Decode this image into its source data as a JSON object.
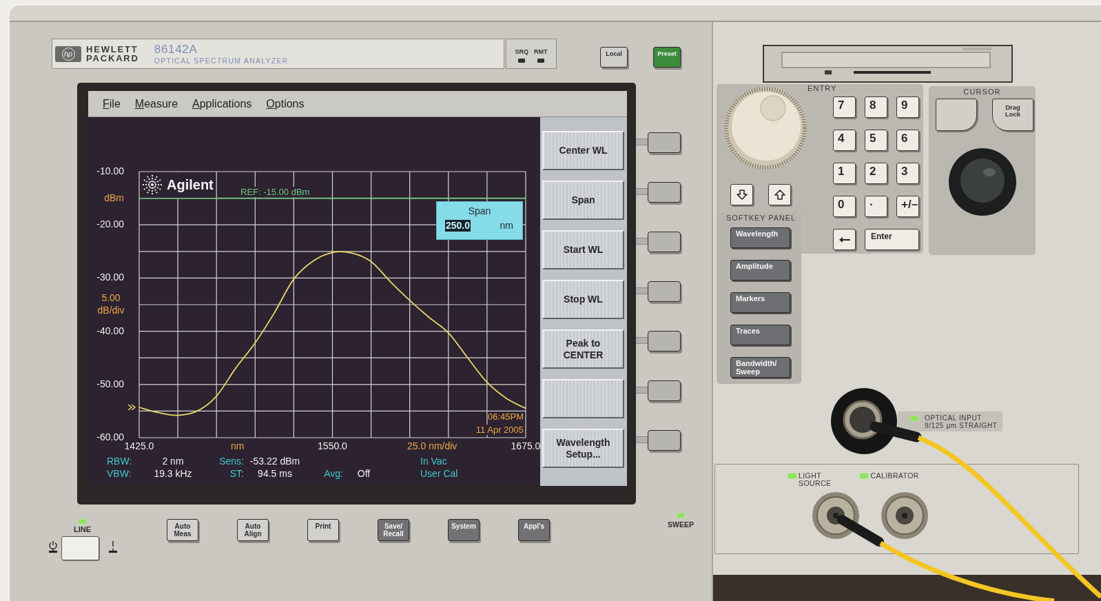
{
  "header": {
    "logo_text": "hp",
    "brand": [
      "HEWLETT",
      "PACKARD"
    ],
    "model": "86142A",
    "product": "OPTICAL SPECTRUM ANALYZER",
    "indicators": [
      {
        "label": "SRQ",
        "on": false
      },
      {
        "label": "RMT",
        "on": false
      }
    ]
  },
  "top_buttons": [
    {
      "label": "Local",
      "kind": "plain"
    },
    {
      "label": "Preset",
      "kind": "green"
    }
  ],
  "screen": {
    "menu": [
      "File",
      "Measure",
      "Applications",
      "Options"
    ],
    "logo_text": "Agilent",
    "y_scale": {
      "value": "5.00",
      "unit": "dB/div"
    },
    "x_scale": "25.0 nm/div",
    "time": "06:45PM",
    "date": "11 Apr 2005",
    "span_dialog": {
      "title": "Span",
      "value": "250.0",
      "unit": "nm"
    },
    "chart_data": {
      "type": "line",
      "xlabel": "nm",
      "ylabel": "dBm",
      "x": [
        1425,
        1437.5,
        1450,
        1462.5,
        1475,
        1487.5,
        1500,
        1512.5,
        1525,
        1537.5,
        1550,
        1562.5,
        1575,
        1587.5,
        1600,
        1612.5,
        1625,
        1637.5,
        1650,
        1662.5,
        1675
      ],
      "series": [
        {
          "color": "#ecd667",
          "values": [
            -54.3,
            -55.3,
            -55.8,
            -55.0,
            -52.2,
            -46.9,
            -42.2,
            -36.5,
            -30.2,
            -26.8,
            -25.2,
            -25.3,
            -26.9,
            -30.7,
            -34.2,
            -37.4,
            -40.3,
            -45.0,
            -49.6,
            -52.6,
            -54.5
          ]
        }
      ],
      "xlim": [
        1425,
        1675
      ],
      "ylim": [
        -60,
        -10
      ],
      "xticks": [
        {
          "value": 1425,
          "label": "1425.0"
        },
        {
          "value": 1550,
          "label": "1550.0"
        },
        {
          "value": 1675,
          "label": "1675.0"
        }
      ],
      "yticks": [
        {
          "value": -10,
          "label": "-10.00"
        },
        {
          "value": -20,
          "label": "-20.00"
        },
        {
          "value": -30,
          "label": "-30.00"
        },
        {
          "value": -40,
          "label": "-40.00"
        },
        {
          "value": -50,
          "label": "-50.00"
        },
        {
          "value": -60,
          "label": "-60.00"
        }
      ],
      "grid": true,
      "ref_lines": [
        {
          "axis": "y",
          "value": -15,
          "label": "REF: -15.00 dBm",
          "color": "#74c67c"
        }
      ]
    },
    "status_rows": [
      [
        {
          "label": "RBW:",
          "value": "2 nm"
        },
        {
          "label": "Sens:",
          "value": "-53.22 dBm"
        }
      ],
      [
        {
          "label": "VBW:",
          "value": "19.3 kHz"
        },
        {
          "label": "ST:",
          "value": "94.5 ms"
        },
        {
          "label": "Avg:",
          "value": "Off"
        }
      ]
    ],
    "calibration": [
      "In Vac",
      "User Cal"
    ],
    "softkeys": [
      {
        "kind": "text",
        "lines": [
          "Center WL"
        ]
      },
      {
        "kind": "text",
        "lines": [
          "Span"
        ]
      },
      {
        "kind": "text",
        "lines": [
          "Start WL"
        ]
      },
      {
        "kind": "text",
        "lines": [
          "Stop WL"
        ]
      },
      {
        "kind": "text",
        "lines": [
          "Peak to",
          "CENTER"
        ]
      },
      {
        "kind": "blank"
      },
      {
        "kind": "text",
        "lines": [
          "Wavelength",
          "Setup..."
        ]
      }
    ]
  },
  "front_panel": {
    "power": {
      "label": "LINE",
      "on": true
    },
    "buttons": [
      {
        "kind": "light",
        "lines": [
          "Auto",
          "Meas"
        ]
      },
      {
        "kind": "light",
        "lines": [
          "Auto",
          "Align"
        ]
      },
      {
        "kind": "light",
        "lines": [
          "Print"
        ]
      },
      {
        "kind": "dark",
        "lines": [
          "Save/",
          "Recall"
        ]
      },
      {
        "kind": "dark",
        "lines": [
          "System"
        ]
      },
      {
        "kind": "dark",
        "lines": [
          "Appl's"
        ]
      }
    ],
    "sweep": {
      "label": "SWEEP",
      "on": true
    }
  },
  "entry": {
    "title": "ENTRY",
    "arrow_keys": [
      {
        "kind": "down"
      },
      {
        "kind": "up"
      }
    ],
    "keys": [
      {
        "kind": "text",
        "label": "7"
      },
      {
        "kind": "text",
        "label": "8"
      },
      {
        "kind": "text",
        "label": "9"
      },
      {
        "kind": "text",
        "label": "4"
      },
      {
        "kind": "text",
        "label": "5"
      },
      {
        "kind": "text",
        "label": "6"
      },
      {
        "kind": "text",
        "label": "1"
      },
      {
        "kind": "text",
        "label": "2"
      },
      {
        "kind": "text",
        "label": "3"
      },
      {
        "kind": "text",
        "label": "0"
      },
      {
        "kind": "text",
        "label": "·"
      },
      {
        "kind": "text",
        "label": "+/–"
      },
      {
        "kind": "backspace"
      },
      {
        "kind": "enter",
        "label": "Enter"
      }
    ]
  },
  "cursor": {
    "title": "CURSOR",
    "keys": [
      {
        "kind": "blank"
      },
      {
        "kind": "text",
        "lines": [
          "Drag",
          "Lock"
        ]
      }
    ]
  },
  "softkey_panel": {
    "title": "SOFTKEY PANEL",
    "buttons": [
      {
        "lines": [
          "Wavelength"
        ]
      },
      {
        "lines": [
          "Amplitude"
        ]
      },
      {
        "lines": [
          "Markers"
        ]
      },
      {
        "lines": [
          "Traces"
        ]
      },
      {
        "lines": [
          "Bandwidth/",
          "Sweep"
        ]
      }
    ]
  },
  "optical_input": {
    "lines": [
      "OPTICAL INPUT",
      "9/125 µm STRAIGHT"
    ],
    "on": true
  },
  "outputs": [
    {
      "lines": [
        "LIGHT",
        "SOURCE"
      ],
      "on": true
    },
    {
      "lines": [
        "CALIBRATOR"
      ],
      "on": true
    }
  ]
}
